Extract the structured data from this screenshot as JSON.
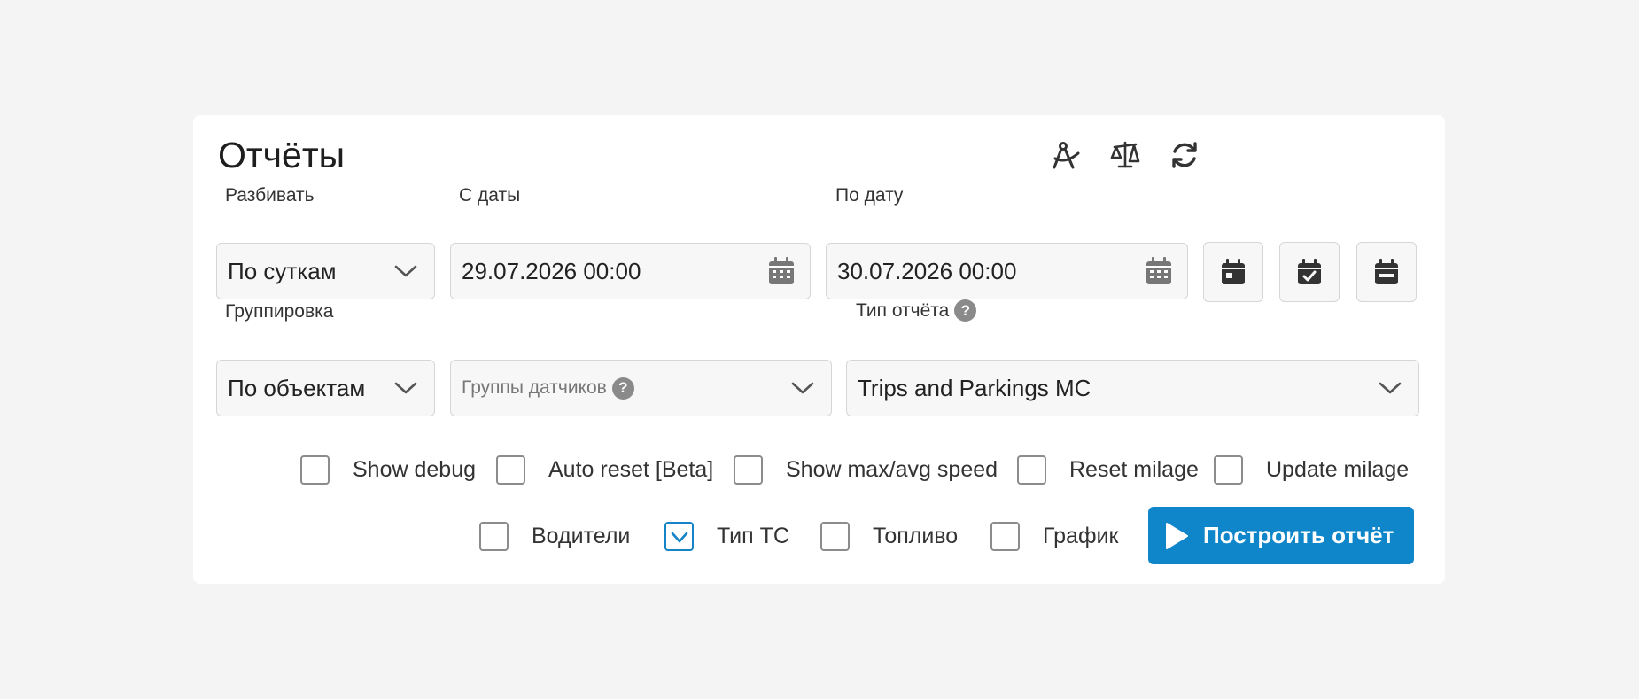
{
  "header": {
    "title": "Отчёты",
    "icons": [
      "compass-icon",
      "scales-icon",
      "refresh-icon"
    ]
  },
  "split": {
    "label": "Разбивать",
    "value": "По суткам"
  },
  "date_from": {
    "label": "С даты",
    "value": "29.07.2026 00:00"
  },
  "date_to": {
    "label": "По дату",
    "value": "30.07.2026 00:00"
  },
  "grouping": {
    "label": "Группировка",
    "value": "По объектам"
  },
  "sensor_groups": {
    "placeholder": "Группы датчиков",
    "help": "?"
  },
  "report_type": {
    "label": "Тип отчёта",
    "help": "?",
    "value": "Trips and Parkings MC"
  },
  "options_row1": [
    {
      "label": "Show debug",
      "checked": false
    },
    {
      "label": "Auto reset [Beta]",
      "checked": false
    },
    {
      "label": "Show max/avg speed",
      "checked": false
    },
    {
      "label": "Reset milage",
      "checked": false
    },
    {
      "label": "Update milage",
      "checked": false
    }
  ],
  "options_row2": [
    {
      "label": "Водители",
      "checked": false
    },
    {
      "label": "Тип ТС",
      "checked": true
    },
    {
      "label": "Топливо",
      "checked": false
    },
    {
      "label": "График",
      "checked": false
    }
  ],
  "build_button": {
    "label": "Построить отчёт"
  },
  "colors": {
    "accent": "#0f86c9",
    "background": "#f4f4f4",
    "card": "#ffffff"
  }
}
